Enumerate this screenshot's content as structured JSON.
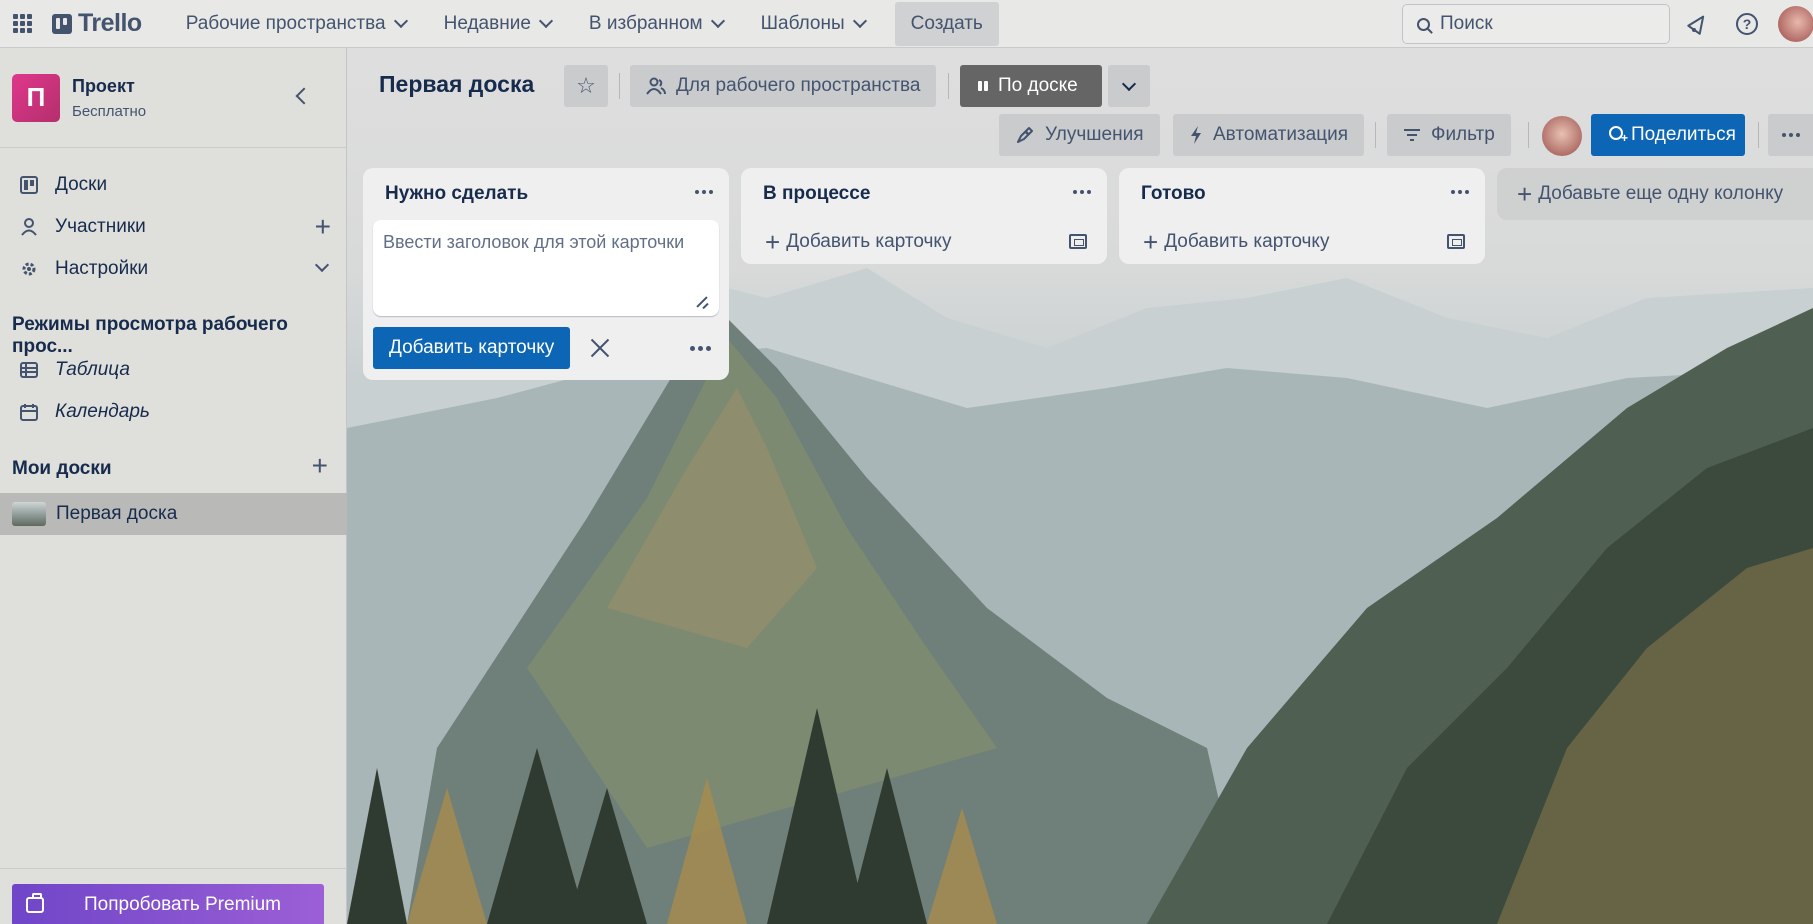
{
  "header": {
    "logo": "Trello",
    "nav": [
      {
        "label": "Рабочие пространства"
      },
      {
        "label": "Недавние"
      },
      {
        "label": "В избранном"
      },
      {
        "label": "Шаблоны"
      }
    ],
    "create_label": "Создать",
    "search_placeholder": "Поиск"
  },
  "sidebar": {
    "workspace": {
      "initial": "П",
      "name": "Проект",
      "plan": "Бесплатно"
    },
    "items": [
      {
        "label": "Доски",
        "icon": "board-icon"
      },
      {
        "label": "Участники",
        "icon": "person-icon"
      },
      {
        "label": "Настройки",
        "icon": "gear-icon"
      }
    ],
    "views_heading": "Режимы просмотра рабочего прос...",
    "views": [
      {
        "label": "Таблица",
        "icon": "table-icon"
      },
      {
        "label": "Календарь",
        "icon": "calendar-icon"
      }
    ],
    "my_boards_heading": "Мои доски",
    "boards": [
      {
        "label": "Первая доска"
      }
    ],
    "premium_label": "Попробовать Premium"
  },
  "board": {
    "title": "Первая доска",
    "visibility_label": "Для рабочего пространства",
    "view_label": "По доске",
    "powerups_label": "Улучшения",
    "automation_label": "Автоматизация",
    "filter_label": "Фильтр",
    "share_label": "Поделиться",
    "lists": [
      {
        "title": "Нужно сделать",
        "composer_placeholder": "Ввести заголовок для этой карточки",
        "add_button": "Добавить карточку"
      },
      {
        "title": "В процессе",
        "add_card": "Добавить карточку"
      },
      {
        "title": "Готово",
        "add_card": "Добавить карточку"
      }
    ],
    "add_list_label": "Добавьте еще одну колонку"
  },
  "colors": {
    "accent": "#0c66b5",
    "premium": "#7e4fd0",
    "workspace_logo": "#d6327f"
  }
}
